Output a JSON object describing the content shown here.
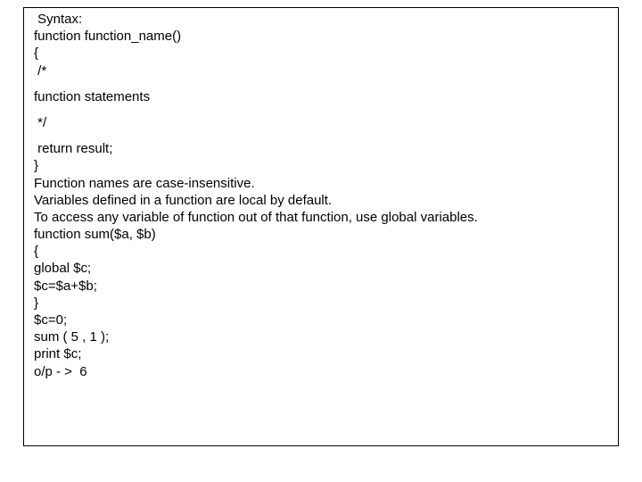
{
  "lines": {
    "l1": " Syntax:",
    "l2": "function function_name()",
    "l3": "{",
    "l4": " /*",
    "l5": "function statements",
    "l6": " */",
    "l7": " return result;",
    "l8": "}",
    "l9": "Function names are case-insensitive.",
    "l10": "Variables defined in a function are local by default.",
    "l11": "To access any variable of function out of that function, use global variables.",
    "l12": "function sum($a, $b)",
    "l13": "{",
    "l14": "global $c;",
    "l15": "$c=$a+$b;",
    "l16": "}",
    "l17": "$c=0;",
    "l18": "sum ( 5 , 1 );",
    "l19": "print $c;",
    "l20": "o/p - >  6"
  }
}
